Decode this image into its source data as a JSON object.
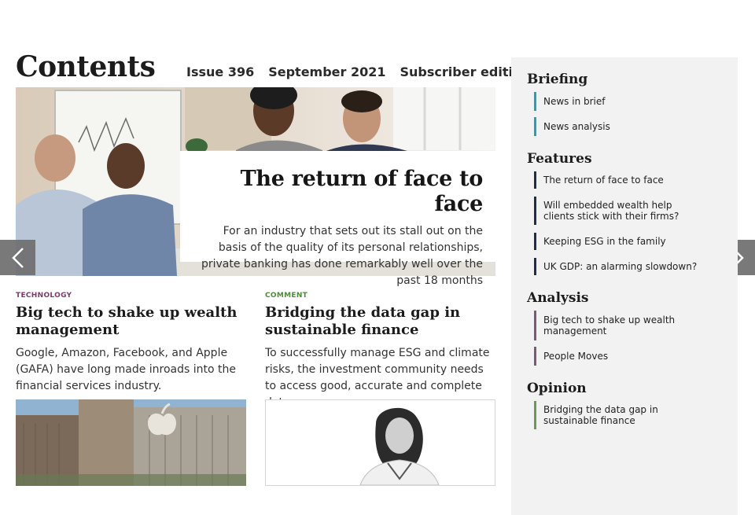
{
  "header": {
    "title": "Contents",
    "issue": "Issue 396",
    "date": "September 2021",
    "edition": "Subscriber edition"
  },
  "hero": {
    "title": "The return of face to face",
    "summary": "For an industry that sets out its stall out on the basis of the quality of its personal relationships, private banking has done remarkably well over the past 18 months"
  },
  "articles": [
    {
      "tag": "TECHNOLOGY",
      "tag_color": "#7a3a6a",
      "headline": "Big tech to shake up wealth management",
      "summary": "Google, Amazon, Facebook, and Apple (GAFA) have long made inroads into the financial services industry."
    },
    {
      "tag": "COMMENT",
      "tag_color": "#4f8a3c",
      "headline": "Bridging the data gap in sustainable finance",
      "summary": "To successfully manage ESG and climate risks, the investment community needs to access good, accurate and complete data."
    }
  ],
  "sidebar": {
    "sections": [
      {
        "title": "Briefing",
        "color": "#1ea2c0",
        "items": [
          "News in brief",
          "News analysis"
        ]
      },
      {
        "title": "Features",
        "color": "#1e2e4a",
        "items": [
          "The return of face to face",
          "Will embedded wealth help clients stick with their firms?",
          "Keeping ESG in the family",
          "UK GDP: an alarming slowdown?"
        ]
      },
      {
        "title": "Analysis",
        "color": "#7a5a74",
        "items": [
          "Big tech to shake up wealth management",
          "People Moves"
        ]
      },
      {
        "title": "Opinion",
        "color": "#6a9a55",
        "items": [
          "Bridging the data gap in sustainable finance"
        ]
      }
    ]
  },
  "icons": {
    "prev": "chevron-left-icon",
    "next": "chevron-right-icon"
  }
}
